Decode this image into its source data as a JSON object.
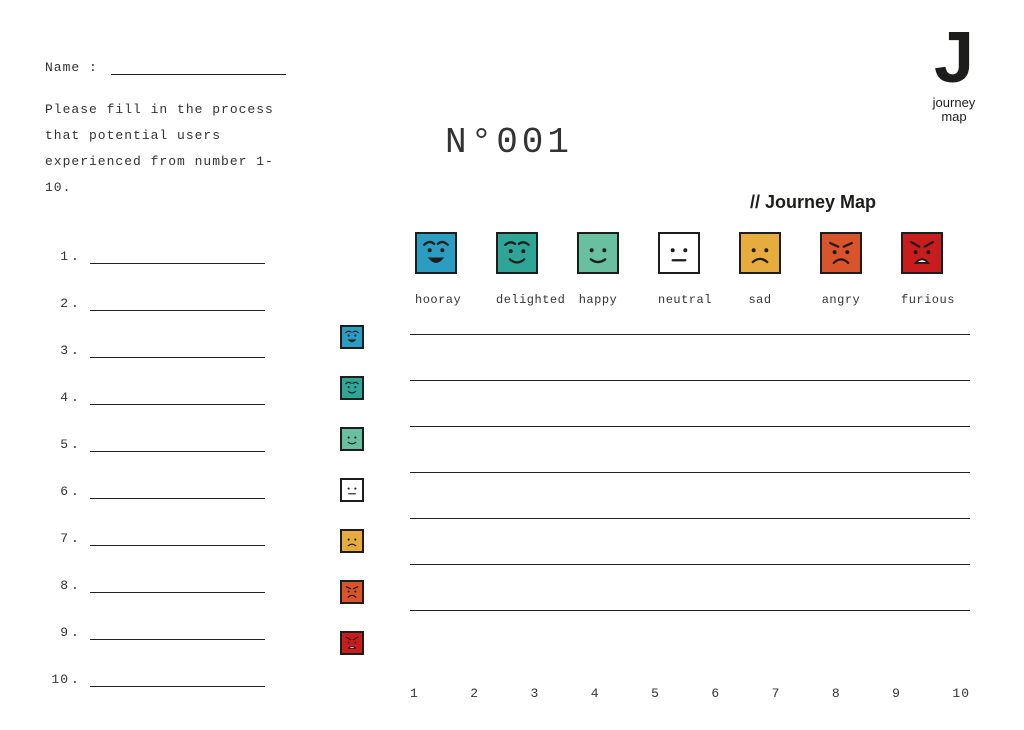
{
  "logo": {
    "letter": "J",
    "sub1": "journey",
    "sub2": "map"
  },
  "form": {
    "name_label": "Name :",
    "instructions": "Please fill in the process that potential users experienced from number 1-10."
  },
  "steps": [
    "1",
    "2",
    "3",
    "4",
    "5",
    "6",
    "7",
    "8",
    "9",
    "10"
  ],
  "title": "N°001",
  "section_label": "// Journey Map",
  "moods": [
    {
      "key": "hooray",
      "label": "hooray",
      "fill": "#2c9dc2"
    },
    {
      "key": "delighted",
      "label": "delighted",
      "fill": "#2fa598"
    },
    {
      "key": "happy",
      "label": "happy",
      "fill": "#69c0a0"
    },
    {
      "key": "neutral",
      "label": "neutral",
      "fill": "#ffffff"
    },
    {
      "key": "sad",
      "label": "sad",
      "fill": "#e6ac3e"
    },
    {
      "key": "angry",
      "label": "angry",
      "fill": "#d9532b"
    },
    {
      "key": "furious",
      "label": "furious",
      "fill": "#c91d1d"
    }
  ],
  "x_axis": [
    "1",
    "2",
    "3",
    "4",
    "5",
    "6",
    "7",
    "8",
    "9",
    "10"
  ]
}
